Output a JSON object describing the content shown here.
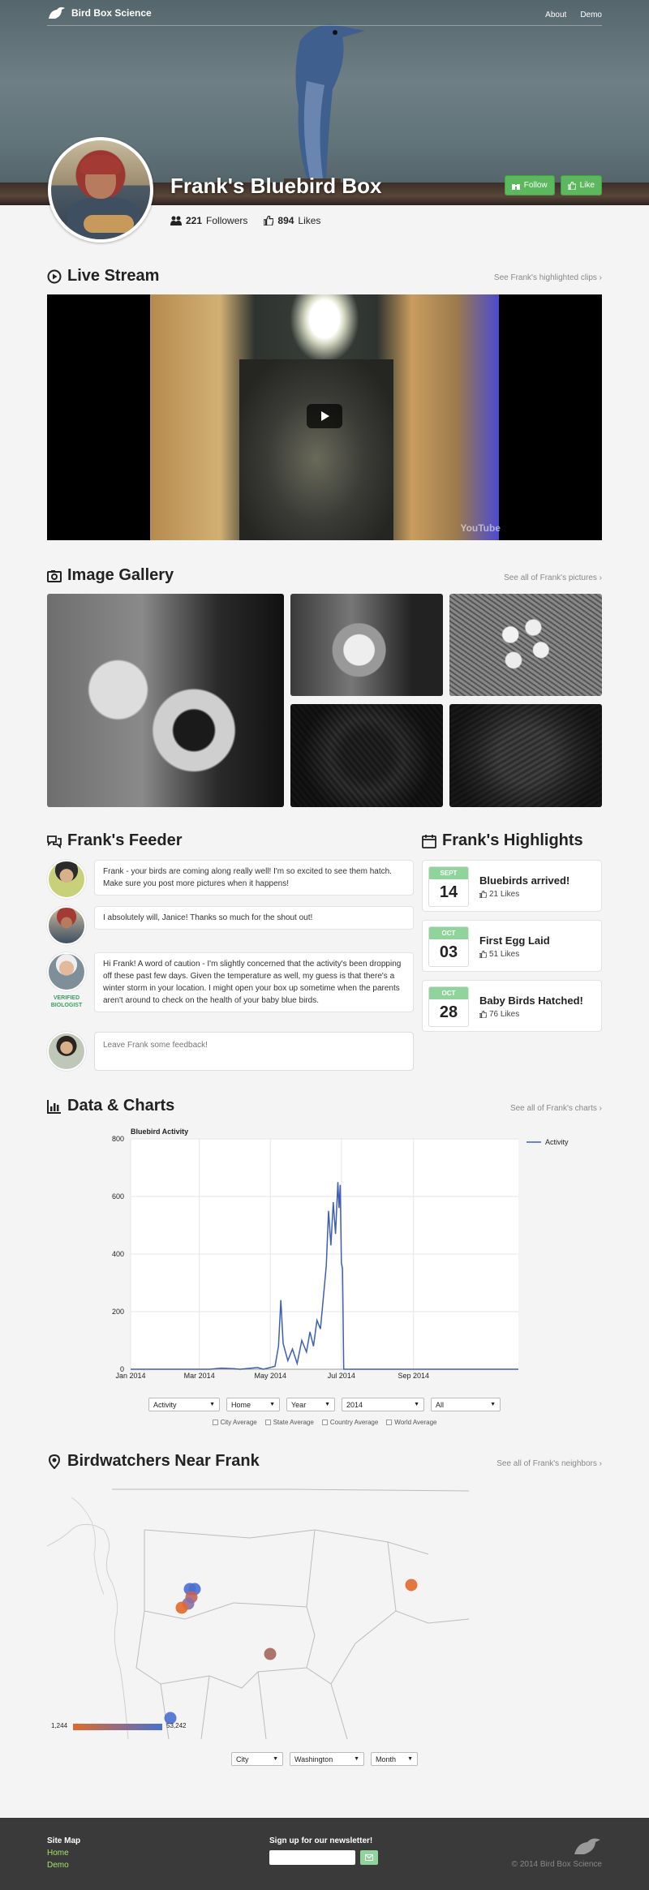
{
  "nav": {
    "brand": "Bird Box Science",
    "links": [
      "About",
      "Demo"
    ]
  },
  "profile": {
    "name": "Frank's Bluebird Box",
    "followers_count": "221",
    "followers_label": "Followers",
    "likes_count": "894",
    "likes_label": "Likes",
    "follow_label": "Follow",
    "like_label": "Like"
  },
  "live": {
    "title": "Live Stream",
    "see": "See Frank's highlighted clips ›",
    "yt": "YouTube"
  },
  "gallery": {
    "title": "Image Gallery",
    "see": "See all of Frank's pictures ›"
  },
  "feeder": {
    "title": "Frank's Feeder",
    "comments": [
      {
        "text": "Frank - your birds are coming along really well! I'm so excited to see them hatch. Make sure you post more pictures when it happens!"
      },
      {
        "text": "I absolutely will, Janice! Thanks so much for the shout out!"
      },
      {
        "text": "Hi Frank! A word of caution - I'm slightly concerned that the activity's been dropping off these past few days. Given the temperature as well, my guess is that there's a winter storm in your location. I might open your box up sometime when the parents aren't around to check on the health of your baby blue birds.",
        "badge": "VERIFIED BIOLOGIST"
      }
    ],
    "placeholder": "Leave Frank some feedback!"
  },
  "highlights": {
    "title": "Frank's Highlights",
    "items": [
      {
        "month": "SEPT",
        "day": "14",
        "title": "Bluebirds arrived!",
        "likes": "21 Likes"
      },
      {
        "month": "OCT",
        "day": "03",
        "title": "First Egg Laid",
        "likes": "51 Likes"
      },
      {
        "month": "OCT",
        "day": "28",
        "title": "Baby Birds Hatched!",
        "likes": "76 Likes"
      }
    ]
  },
  "charts": {
    "title": "Data & Charts",
    "see": "See all of Frank's charts ›"
  },
  "chart_data": {
    "type": "line",
    "title": "Bluebird Activity",
    "legend": "Activity",
    "legend_position": "top-right",
    "grid": true,
    "ylim": [
      0,
      800
    ],
    "yticks": [
      0,
      200,
      400,
      600,
      800
    ],
    "xticks": [
      "Jan 2014",
      "Mar 2014",
      "May 2014",
      "Jul 2014",
      "Sep 2014"
    ],
    "x_range": [
      "2014-01-01",
      "2014-11-30"
    ],
    "series": [
      {
        "name": "Activity",
        "points": [
          [
            "2014-01-01",
            0
          ],
          [
            "2014-03-10",
            0
          ],
          [
            "2014-03-20",
            4
          ],
          [
            "2014-03-30",
            2
          ],
          [
            "2014-04-05",
            0
          ],
          [
            "2014-04-20",
            6
          ],
          [
            "2014-04-25",
            0
          ],
          [
            "2014-05-05",
            10
          ],
          [
            "2014-05-08",
            80
          ],
          [
            "2014-05-10",
            240
          ],
          [
            "2014-05-12",
            90
          ],
          [
            "2014-05-16",
            30
          ],
          [
            "2014-05-20",
            70
          ],
          [
            "2014-05-24",
            20
          ],
          [
            "2014-05-28",
            100
          ],
          [
            "2014-06-01",
            60
          ],
          [
            "2014-06-04",
            130
          ],
          [
            "2014-06-07",
            80
          ],
          [
            "2014-06-10",
            170
          ],
          [
            "2014-06-13",
            140
          ],
          [
            "2014-06-16",
            270
          ],
          [
            "2014-06-18",
            360
          ],
          [
            "2014-06-20",
            550
          ],
          [
            "2014-06-22",
            430
          ],
          [
            "2014-06-24",
            580
          ],
          [
            "2014-06-26",
            470
          ],
          [
            "2014-06-28",
            650
          ],
          [
            "2014-06-29",
            560
          ],
          [
            "2014-06-30",
            640
          ],
          [
            "2014-07-01",
            370
          ],
          [
            "2014-07-02",
            350
          ],
          [
            "2014-07-03",
            0
          ],
          [
            "2014-11-30",
            0
          ]
        ]
      }
    ]
  },
  "chart_controls": {
    "selects": [
      "Activity",
      "Home",
      "Year",
      "2014",
      "All"
    ],
    "checks": [
      "City Average",
      "State Average",
      "Country Average",
      "World Average"
    ]
  },
  "neighbors": {
    "title": "Birdwatchers Near Frank",
    "see": "See all of Frank's neighbors ›",
    "legend_min": "1,244",
    "legend_max": "53,242",
    "selects": [
      "City",
      "Washington",
      "Month"
    ]
  },
  "footer": {
    "sitemap": "Site Map",
    "links": [
      "Home",
      "Demo"
    ],
    "newsletter": "Sign up for our newsletter!",
    "copyright": "© 2014 Bird Box Science"
  },
  "colors": {
    "accent_green": "#5cb85c",
    "calendar_green": "#8fd49a",
    "line_blue": "#3f5fb5",
    "map_orange": "#e06a2b",
    "map_blue": "#4a6fd1"
  }
}
